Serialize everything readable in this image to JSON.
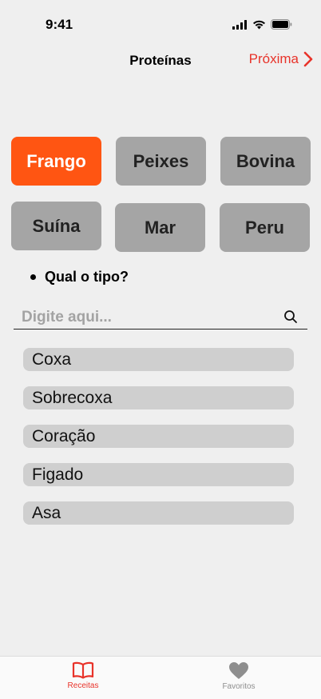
{
  "status": {
    "time": "9:41"
  },
  "nav": {
    "title": "Proteínas",
    "next_label": "Próxima"
  },
  "chips": [
    {
      "label": "Frango",
      "selected": true
    },
    {
      "label": "Peixes",
      "selected": false
    },
    {
      "label": "Bovina",
      "selected": false
    },
    {
      "label": "Suína",
      "selected": false
    },
    {
      "label": "Mar",
      "selected": false
    },
    {
      "label": "Peru",
      "selected": false
    }
  ],
  "question": "Qual o tipo?",
  "search": {
    "placeholder": "Digite aqui...",
    "value": ""
  },
  "items": [
    "Coxa",
    "Sobrecoxa",
    "Coração",
    "Figado",
    "Asa"
  ],
  "tabbar": {
    "tabs": [
      {
        "label": "Receitas",
        "icon": "book-icon",
        "active": true
      },
      {
        "label": "Favoritos",
        "icon": "heart-icon",
        "active": false
      }
    ]
  },
  "colors": {
    "accent": "#ff5512",
    "link": "#e8332a",
    "chip": "#a5a5a5",
    "item": "#cfcfcf",
    "background": "#efefef"
  }
}
